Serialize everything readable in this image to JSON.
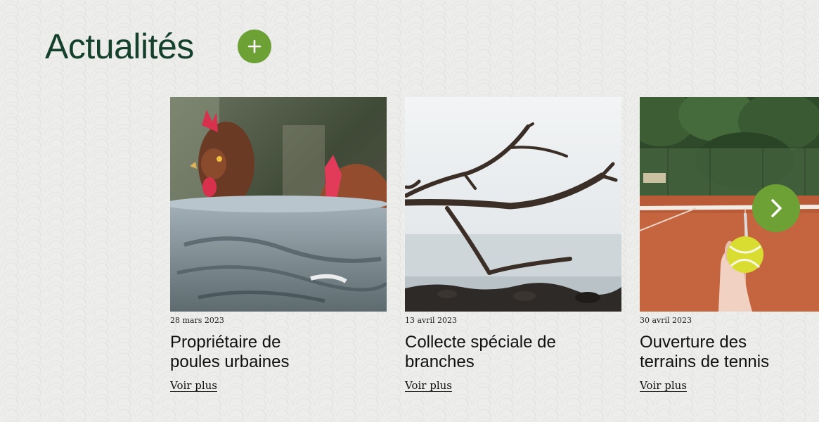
{
  "section": {
    "title": "Actualités",
    "add_icon": "plus-icon",
    "next_icon": "chevron-right-icon"
  },
  "colors": {
    "title": "#14402c",
    "accent": "#6da035",
    "background": "#ededec"
  },
  "news": [
    {
      "date": "28 mars 2023",
      "title_line1": "Propriétaire de",
      "title_line2": "poules urbaines",
      "link": "Voir plus"
    },
    {
      "date": "13 avril 2023",
      "title_line1": "Collecte spéciale de",
      "title_line2": "branches",
      "link": "Voir plus"
    },
    {
      "date": "30 avril 2023",
      "title_line1": "Ouverture des",
      "title_line2": "terrains de tennis",
      "link": "Voir plus"
    }
  ]
}
